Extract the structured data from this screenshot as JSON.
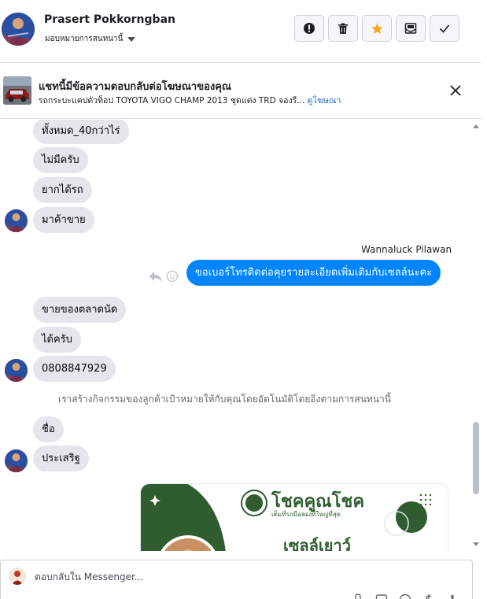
{
  "header": {
    "user_name": "Prasert Pokkorngban",
    "assign_label": "มอบหมายการสนทนานี้",
    "actions": [
      {
        "name": "report-button",
        "icon": "exclamation-icon"
      },
      {
        "name": "delete-button",
        "icon": "trash-icon"
      },
      {
        "name": "star-button",
        "icon": "star-icon",
        "color": "#f5a623"
      },
      {
        "name": "mark-spam-button",
        "icon": "spam-envelope-icon"
      },
      {
        "name": "mark-done-button",
        "icon": "check-icon"
      }
    ]
  },
  "ad_banner": {
    "title": "แชทนี้มีข้อความตอบกลับต่อโฆษณาของคุณ",
    "subtitle": "รถกระบะแคปตัวท็อป TOYOTA VIGO CHAMP 2013 ชุดแต่ง TRD จองรี...",
    "link_text": "ดูโฆษณา"
  },
  "messages": {
    "m1": "ทั้งหมด_40กว่าไร่",
    "m2": "ไม่มีครับ",
    "m3": "ยากได้รถ",
    "m4": "มาค้าขาย",
    "outgoing_sender": "Wannaluck Pilawan",
    "outgoing": "ขอเบอร์โทรติดต่อคุยรายละเอียดเพิ่มเติมกับเซลล์นะคะ",
    "m5": "ขายของตลาดนัด",
    "m6": "ได้ครับ",
    "m7": "0808847929",
    "system_note": "เราสร้างกิจกรรมของลูกค้าเป้าหมายให้กับคุณโดยอัตโนมัติโดยอิงตามการสนทนานี้",
    "m8": "ชื่อ",
    "m9": "ประเสริฐ"
  },
  "ad_image": {
    "brand": "โชคคูณโชค",
    "brand_tagline": "เต็มที่รถมือสองที่ใหญ่ที่สุด",
    "sales_name": "เซลล์เยาว์"
  },
  "composer": {
    "placeholder": "ตอบกลับใน Messenger..."
  },
  "colors": {
    "outgoing_bubble": "#0084ff",
    "incoming_bubble": "#e4e6eb",
    "link": "#216fdb",
    "brand_green": "#2f5d2f"
  }
}
